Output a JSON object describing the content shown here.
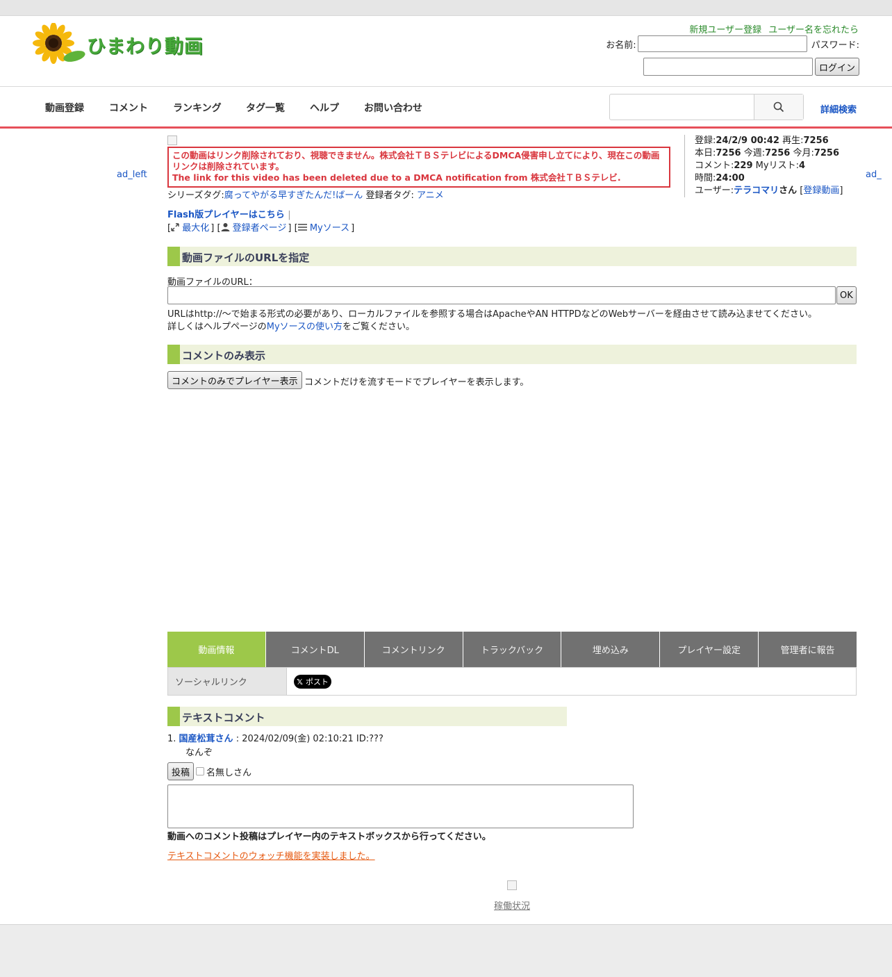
{
  "header": {
    "logo_text": "ひまわり動画",
    "register_link": "新規ユーザー登録",
    "forgot_link": "ユーザー名を忘れたら",
    "name_label": "お名前:",
    "password_label": "パスワード:",
    "login_button": "ログイン"
  },
  "nav": {
    "items": [
      "動画登録",
      "コメント",
      "ランキング",
      "タグ一覧",
      "ヘルプ",
      "お問い合わせ"
    ],
    "advanced_search": "詳細検索"
  },
  "ads": {
    "left": "ad_left",
    "right": "ad_"
  },
  "notice": {
    "line1": "この動画はリンク削除されており、視聴できません。株式会社ＴＢＳテレビによるDMCA侵害申し立てにより、現在この動画リンクは削除されています。",
    "line2": "The link for this video has been deleted due to a DMCA notification from 株式会社ＴＢＳテレビ."
  },
  "tags": {
    "series_label": "シリーズタグ:",
    "series_value": "腐ってやがる早すぎたんだ!ばーん",
    "owner_label": "登録者タグ:",
    "owner_value": "アニメ"
  },
  "stats": {
    "registered_label": "登録:",
    "registered_value": "24/2/9 00:42",
    "plays_label": "再生:",
    "plays_value": "7256",
    "today_label": "本日:",
    "today_value": "7256",
    "week_label": "今週:",
    "week_value": "7256",
    "month_label": "今月:",
    "month_value": "7256",
    "comments_label": "コメント:",
    "comments_value": "229",
    "mylist_label": "Myリスト:",
    "mylist_value": "4",
    "time_label": "時間:",
    "time_value": "24:00",
    "user_label": "ユーザー:",
    "user_name": "テラコマリ",
    "user_suffix": "さん",
    "user_videos": "登録動画"
  },
  "links": {
    "flash_player": "Flash版プレイヤーはこちら",
    "maximize": "最大化",
    "owner_page": "登録者ページ",
    "my_source": "Myソース"
  },
  "url_section": {
    "title": "動画ファイルのURLを指定",
    "label": "動画ファイルのURL：",
    "ok_button": "OK",
    "note1": "URLはhttp://～で始まる形式の必要があり、ローカルファイルを参照する場合はApacheやAN HTTPDなどのWebサーバーを経由させて読み込ませてください。",
    "note2_prefix": "詳しくはヘルプページの",
    "note2_link": "Myソースの使い方",
    "note2_suffix": "をご覧ください。"
  },
  "comment_only": {
    "title": "コメントのみ表示",
    "button": "コメントのみでプレイヤー表示",
    "note": "コメントだけを流すモードでプレイヤーを表示します。"
  },
  "tabs": [
    "動画情報",
    "コメントDL",
    "コメントリンク",
    "トラックバック",
    "埋め込み",
    "プレイヤー設定",
    "管理者に報告"
  ],
  "social": {
    "label": "ソーシャルリンク",
    "x_button": "ポスト"
  },
  "text_comments": {
    "title": "テキストコメント",
    "entries": [
      {
        "number": "1.",
        "author": "国産松茸さん",
        "meta": ": 2024/02/09(金) 02:10:21 ID:???",
        "body": "なんぞ"
      }
    ],
    "post_button": "投稿",
    "anonymous_label": "名無しさん",
    "bold_note": "動画へのコメント投稿はプレイヤー内のテキストボックスから行ってください。",
    "watch_link": "テキストコメントのウォッチ機能を実装しました。"
  },
  "footer": {
    "status_link": "稼働状況"
  },
  "colors": {
    "accent_green": "#9dc84a",
    "alert_red": "#d9363e",
    "nav_underline": "#e6505a",
    "tab_gray": "#717171"
  }
}
